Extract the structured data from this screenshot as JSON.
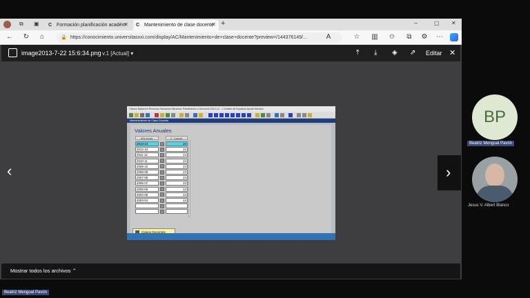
{
  "tabs": [
    {
      "favicon": "C",
      "label": "Formación planificación académ"
    },
    {
      "favicon": "C",
      "label": "Mantenimiento de clase docente"
    }
  ],
  "address": {
    "url": "https://conocimiento.universitasxxi.com/display/AC/Mantenimiento+de+clase+docente?preview=/144376149/..."
  },
  "viewer": {
    "file_title": "image2013-7-22 15:6:34.png",
    "version": "v.1 [Actual]",
    "edit_label": "Editar",
    "footer_label": "Mostrar todos los archivos"
  },
  "screenshot": {
    "menu_text": "Cálculo Balances   Recursos Humanos   Ejercicios   Planificación y Docencia   2013-14 - 1   Gestión de Espacios   Ayuda   Window",
    "window_title": "Mantenimiento de Clase Docente",
    "heading": "Valores Anuales",
    "col_year": "Año Acad.",
    "col_class": "C. Cancel.",
    "rows": [
      {
        "year": "2013-14",
        "value": "24"
      },
      {
        "year": "2012-13",
        "value": "24"
      },
      {
        "year": "2011-12",
        "value": "24"
      },
      {
        "year": "2010-11",
        "value": "24"
      },
      {
        "year": "2009-10",
        "value": "24"
      },
      {
        "year": "2008-09",
        "value": "24"
      },
      {
        "year": "2007-08",
        "value": "24"
      },
      {
        "year": "2006-07",
        "value": "24"
      },
      {
        "year": "2005-06",
        "value": "24"
      },
      {
        "year": "2004-05",
        "value": "24"
      },
      {
        "year": "2003-04",
        "value": "24"
      },
      {
        "year": "",
        "value": ""
      },
      {
        "year": "",
        "value": ""
      }
    ],
    "button_label": "Clases Docentes"
  },
  "participants": [
    {
      "initials": "BP",
      "name": "Beatriz Mengual Pavón"
    },
    {
      "name": "Jesus V. Albert Blanco"
    }
  ],
  "bottom_label": "Beatriz Mengual Pavón"
}
